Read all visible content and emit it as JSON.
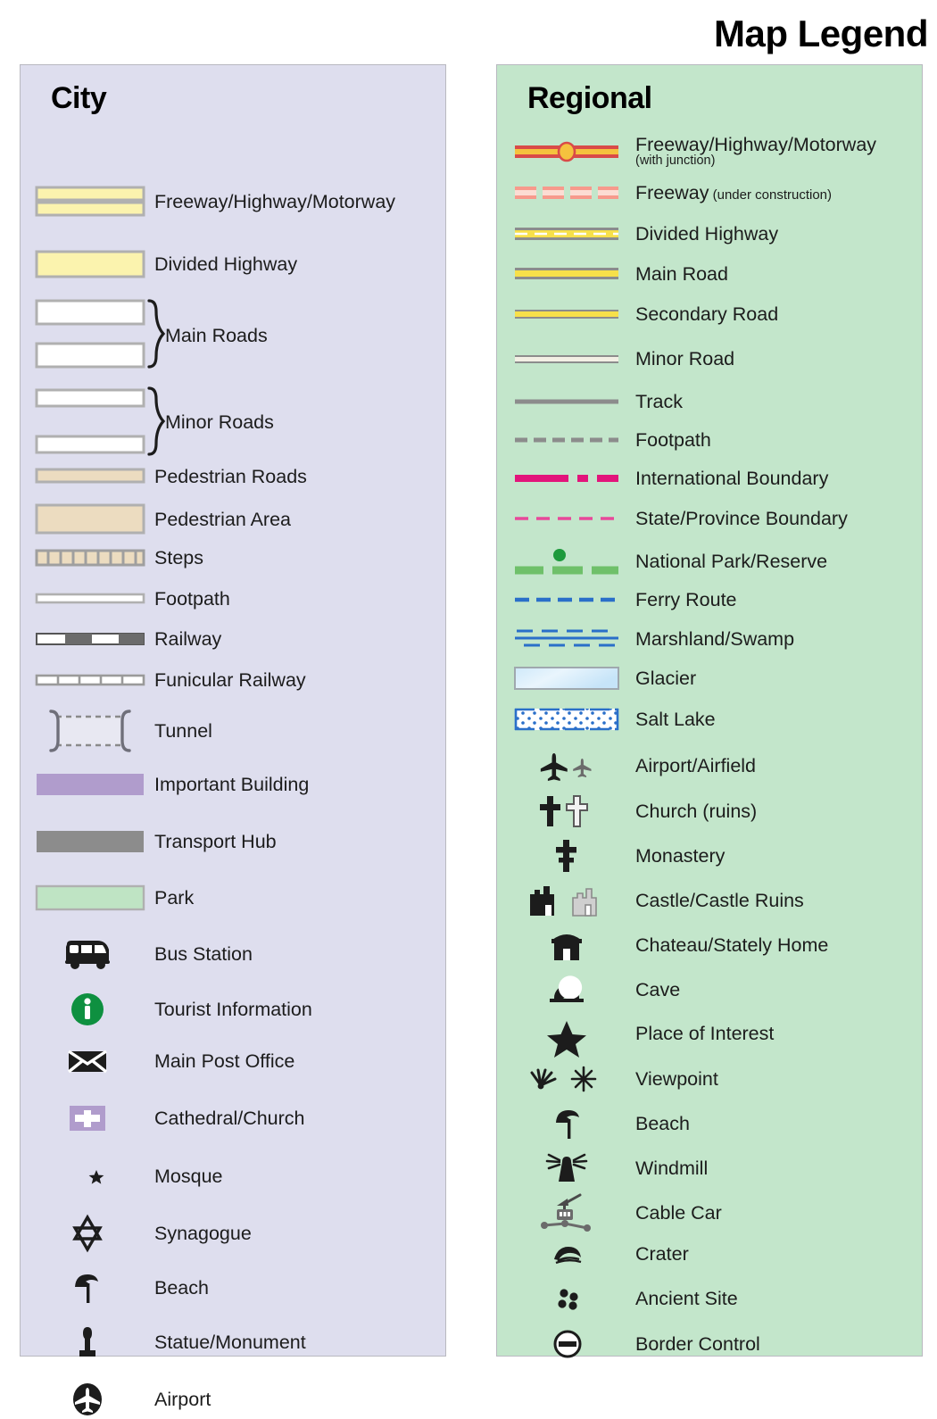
{
  "title": "Map Legend",
  "colors": {
    "city_panel_bg": "#dedeee",
    "regional_panel_bg": "#c3e6cb",
    "panel_border": "#b9b9c0",
    "road_yellow": "#fbf3ae",
    "road_casing_gray": "#b0b0b0",
    "pedestrian_tan": "#ecdcc0",
    "important_building_purple": "#b09ccc",
    "transport_hub_gray": "#8c8c8c",
    "park_green": "#bfe4c4",
    "tourist_green": "#0e9040",
    "freeway_red": "#d94b48",
    "freeway_orange": "#f5c23e",
    "construction_pink": "#f79a8c",
    "main_road_yellow": "#f7e04a",
    "track_gray": "#8c8c8c",
    "intl_boundary_magenta": "#e2157b",
    "state_boundary_pink": "#e8489a",
    "park_reserve_green": "#6fc06a",
    "ferry_blue": "#2a6fc9",
    "glacier_blue": "#d5ecfa",
    "salt_lake_blue": "#2a6fc9",
    "text": "#1c1c1c"
  },
  "city": {
    "heading": "City",
    "items": [
      {
        "icon": "freeway-swatch",
        "label": "Freeway/Highway/Motorway"
      },
      {
        "icon": "divided-highway-swatch",
        "label": "Divided Highway"
      },
      {
        "icon": "main-roads-bracket",
        "label": "Main Roads"
      },
      {
        "icon": "minor-roads-bracket",
        "label": "Minor Roads"
      },
      {
        "icon": "pedestrian-road-swatch",
        "label": "Pedestrian Roads"
      },
      {
        "icon": "pedestrian-area-swatch",
        "label": "Pedestrian Area"
      },
      {
        "icon": "steps-swatch",
        "label": "Steps"
      },
      {
        "icon": "footpath-line",
        "label": "Footpath"
      },
      {
        "icon": "railway-line",
        "label": "Railway"
      },
      {
        "icon": "funicular-railway-line",
        "label": "Funicular Railway"
      },
      {
        "icon": "tunnel-symbol",
        "label": "Tunnel"
      },
      {
        "icon": "important-building-swatch",
        "label": "Important Building"
      },
      {
        "icon": "transport-hub-swatch",
        "label": "Transport Hub"
      },
      {
        "icon": "park-swatch",
        "label": "Park"
      },
      {
        "icon": "bus-icon",
        "label": "Bus Station"
      },
      {
        "icon": "tourist-information-icon",
        "label": "Tourist Information"
      },
      {
        "icon": "envelope-icon",
        "label": "Main Post Office"
      },
      {
        "icon": "cathedral-cross-icon",
        "label": "Cathedral/Church"
      },
      {
        "icon": "mosque-crescent-icon",
        "label": "Mosque"
      },
      {
        "icon": "star-of-david-icon",
        "label": "Synagogue"
      },
      {
        "icon": "beach-umbrella-icon",
        "label": "Beach"
      },
      {
        "icon": "statue-icon",
        "label": "Statue/Monument"
      },
      {
        "icon": "airport-circle-icon",
        "label": "Airport"
      }
    ]
  },
  "regional": {
    "heading": "Regional",
    "items": [
      {
        "icon": "freeway-junction-line",
        "label": "Freeway/Highway/Motorway",
        "sub": "(with junction)"
      },
      {
        "icon": "freeway-construction-line",
        "label": "Freeway",
        "inline_sub": "(under construction)"
      },
      {
        "icon": "divided-highway-line",
        "label": "Divided Highway"
      },
      {
        "icon": "main-road-line",
        "label": "Main Road"
      },
      {
        "icon": "secondary-road-line",
        "label": "Secondary Road"
      },
      {
        "icon": "minor-road-line",
        "label": "Minor Road"
      },
      {
        "icon": "track-line",
        "label": "Track"
      },
      {
        "icon": "footpath-dashed-line",
        "label": "Footpath"
      },
      {
        "icon": "international-boundary-line",
        "label": "International Boundary"
      },
      {
        "icon": "state-boundary-line",
        "label": "State/Province Boundary"
      },
      {
        "icon": "national-park-line",
        "label": "National Park/Reserve"
      },
      {
        "icon": "ferry-route-line",
        "label": "Ferry Route"
      },
      {
        "icon": "marshland-symbol",
        "label": "Marshland/Swamp"
      },
      {
        "icon": "glacier-swatch",
        "label": "Glacier"
      },
      {
        "icon": "salt-lake-swatch",
        "label": "Salt Lake"
      },
      {
        "icon": "airplane-icon",
        "label": "Airport/Airfield"
      },
      {
        "icon": "church-cross-icon",
        "label": "Church (ruins)"
      },
      {
        "icon": "monastery-cross-icon",
        "label": "Monastery"
      },
      {
        "icon": "castle-icon",
        "label": "Castle/Castle Ruins"
      },
      {
        "icon": "chateau-icon",
        "label": "Chateau/Stately Home"
      },
      {
        "icon": "cave-icon",
        "label": "Cave"
      },
      {
        "icon": "star-icon",
        "label": "Place of Interest"
      },
      {
        "icon": "viewpoint-icon",
        "label": "Viewpoint"
      },
      {
        "icon": "beach-umbrella-icon",
        "label": "Beach"
      },
      {
        "icon": "windmill-icon",
        "label": "Windmill"
      },
      {
        "icon": "cable-car-icon",
        "label": "Cable Car"
      },
      {
        "icon": "crater-icon",
        "label": "Crater"
      },
      {
        "icon": "ancient-site-icon",
        "label": "Ancient Site"
      },
      {
        "icon": "border-control-icon",
        "label": "Border Control"
      }
    ]
  }
}
